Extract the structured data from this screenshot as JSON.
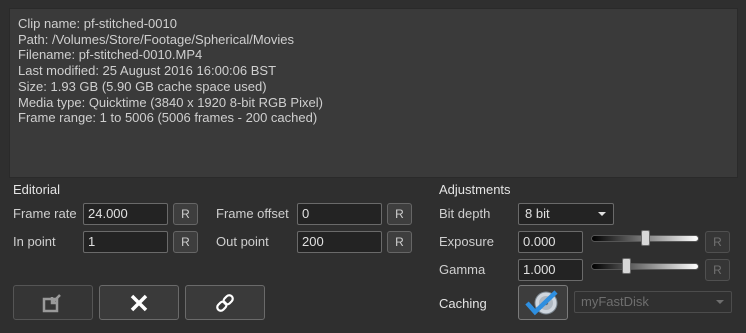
{
  "info": {
    "lines": [
      "Clip name: pf-stitched-0010",
      "Path: /Volumes/Store/Footage/Spherical/Movies",
      "Filename: pf-stitched-0010.MP4",
      "Last modified: 25 August 2016 16:00:06 BST",
      "Size: 1.93 GB (5.90 GB cache space used)",
      "Media type: Quicktime (3840 x 1920 8-bit RGB Pixel)",
      "Frame range: 1 to 5006 (5006 frames - 200 cached)"
    ]
  },
  "editorial": {
    "title": "Editorial",
    "frame_rate_label": "Frame rate",
    "frame_rate_value": "24.000",
    "frame_offset_label": "Frame offset",
    "frame_offset_value": "0",
    "in_point_label": "In point",
    "in_point_value": "1",
    "out_point_label": "Out point",
    "out_point_value": "200",
    "reset_label": "R"
  },
  "adjustments": {
    "title": "Adjustments",
    "bit_depth_label": "Bit depth",
    "bit_depth_value": "8 bit",
    "exposure_label": "Exposure",
    "exposure_value": "0.000",
    "exposure_slider_fraction": 0.5,
    "gamma_label": "Gamma",
    "gamma_value": "1.000",
    "gamma_slider_fraction": 0.31,
    "reset_label": "R"
  },
  "caching": {
    "label": "Caching",
    "disk_value": "myFastDisk"
  },
  "toolbar": {
    "import_icon": "import-icon",
    "delete_icon": "close-icon",
    "link_icon": "link-icon"
  },
  "colors": {
    "background": "#2f2f2f",
    "panel": "#3a3a3a",
    "check_accent": "#2e8fe0"
  }
}
